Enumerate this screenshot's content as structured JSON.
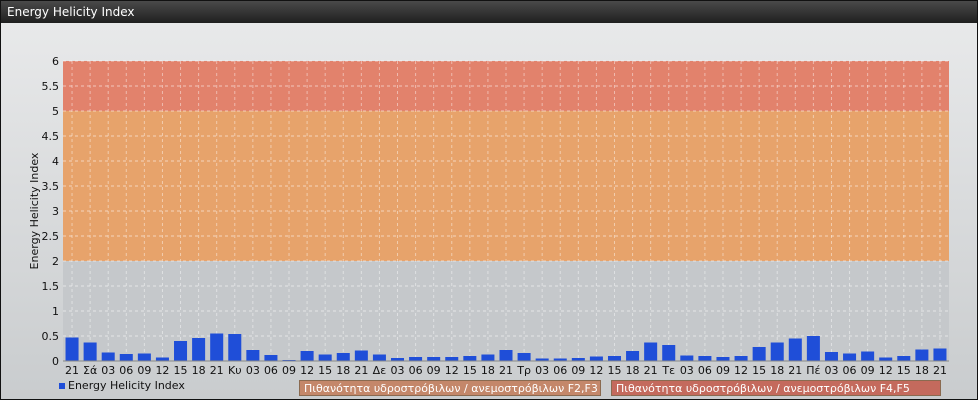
{
  "window": {
    "title": "Energy Helicity Index"
  },
  "legend": {
    "series_label": "Energy Helicity Index",
    "band1_label": "Πιθανότητα υδροστρόβιλων / ανεμοστρόβιλων F2,F3",
    "band2_label": "Πιθανότητα υδροστρόβιλων / ανεμοστρόβιλων F4,F5"
  },
  "colors": {
    "bar": "#1f4ed8",
    "band_low": "#e7a36b",
    "band_high": "#e2826c",
    "grid": "#ffffff"
  },
  "chart_data": {
    "type": "bar",
    "ylabel": "Energy Helicity Index",
    "ylim": [
      0,
      6
    ],
    "yticks": [
      "0",
      "0.5",
      "1",
      "1.5",
      "2",
      "2.5",
      "3",
      "3.5",
      "4",
      "4.5",
      "5",
      "5.5",
      "6"
    ],
    "categories": [
      "21",
      "Σά",
      "03",
      "06",
      "09",
      "12",
      "15",
      "18",
      "21",
      "Κυ",
      "03",
      "06",
      "09",
      "12",
      "15",
      "18",
      "21",
      "Δε",
      "03",
      "06",
      "09",
      "12",
      "15",
      "18",
      "21",
      "Τρ",
      "03",
      "06",
      "09",
      "12",
      "15",
      "18",
      "21",
      "Τε",
      "03",
      "06",
      "09",
      "12",
      "15",
      "18",
      "21",
      "Πέ",
      "03",
      "06",
      "09",
      "12",
      "15",
      "18",
      "21"
    ],
    "values": [
      0.47,
      0.37,
      0.17,
      0.14,
      0.15,
      0.07,
      0.4,
      0.46,
      0.55,
      0.54,
      0.22,
      0.12,
      0.02,
      0.2,
      0.13,
      0.16,
      0.21,
      0.13,
      0.06,
      0.08,
      0.08,
      0.08,
      0.1,
      0.13,
      0.22,
      0.16,
      0.05,
      0.05,
      0.06,
      0.09,
      0.1,
      0.2,
      0.37,
      0.32,
      0.11,
      0.1,
      0.08,
      0.1,
      0.28,
      0.37,
      0.45,
      0.5,
      0.18,
      0.15,
      0.19,
      0.07,
      0.1,
      0.23,
      0.25
    ],
    "bands": [
      {
        "from": 2,
        "to": 5
      },
      {
        "from": 5,
        "to": 6
      }
    ],
    "grid": true,
    "legend_position": "bottom-left"
  }
}
